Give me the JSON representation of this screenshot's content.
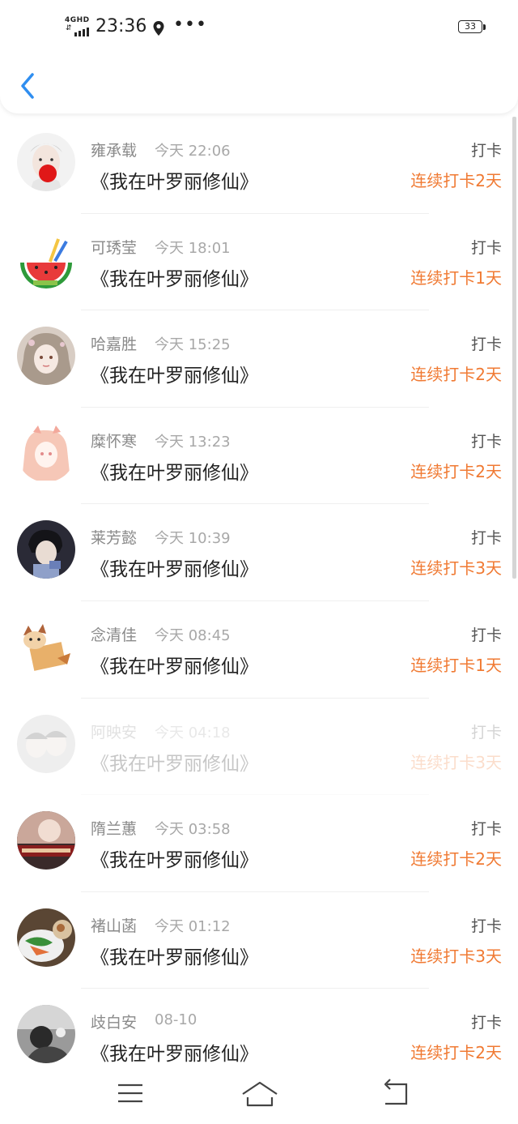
{
  "status_bar": {
    "network": "4GHD",
    "time": "23:36",
    "more": "•••",
    "battery": "33"
  },
  "header": {
    "back_icon": "chevron-left-icon",
    "accent_color": "#2f8ef0"
  },
  "list": [
    {
      "name": "雍承载",
      "date": "今天 22:06",
      "book": "《我在叶罗丽修仙》",
      "tag": "打卡",
      "streak": "连续打卡2天"
    },
    {
      "name": "可琇莹",
      "date": "今天 18:01",
      "book": "《我在叶罗丽修仙》",
      "tag": "打卡",
      "streak": "连续打卡1天"
    },
    {
      "name": "哈嘉胜",
      "date": "今天 15:25",
      "book": "《我在叶罗丽修仙》",
      "tag": "打卡",
      "streak": "连续打卡2天"
    },
    {
      "name": "糜怀寒",
      "date": "今天 13:23",
      "book": "《我在叶罗丽修仙》",
      "tag": "打卡",
      "streak": "连续打卡2天"
    },
    {
      "name": "莱芳懿",
      "date": "今天 10:39",
      "book": "《我在叶罗丽修仙》",
      "tag": "打卡",
      "streak": "连续打卡3天"
    },
    {
      "name": "念清佳",
      "date": "今天 08:45",
      "book": "《我在叶罗丽修仙》",
      "tag": "打卡",
      "streak": "连续打卡1天"
    },
    {
      "name": "阿映安",
      "date": "今天 04:18",
      "book": "《我在叶罗丽修仙》",
      "tag": "打卡",
      "streak": "连续打卡3天"
    },
    {
      "name": "隋兰蕙",
      "date": "今天 03:58",
      "book": "《我在叶罗丽修仙》",
      "tag": "打卡",
      "streak": "连续打卡2天"
    },
    {
      "name": "褚山菡",
      "date": "今天 01:12",
      "book": "《我在叶罗丽修仙》",
      "tag": "打卡",
      "streak": "连续打卡3天"
    },
    {
      "name": "歧白安",
      "date": "08-10",
      "book": "《我在叶罗丽修仙》",
      "tag": "打卡",
      "streak": "连续打卡2天"
    }
  ],
  "colors": {
    "streak": "#f07a33",
    "name": "#8a8a8a",
    "date": "#a8a8a8"
  },
  "navbar": {
    "menu_icon": "menu-icon",
    "home_icon": "home-icon",
    "back_icon": "back-icon"
  }
}
